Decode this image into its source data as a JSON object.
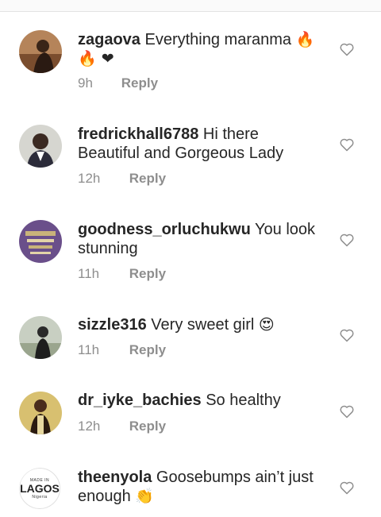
{
  "reply_label": "Reply",
  "comments": [
    {
      "username": "zagaova",
      "text": "Everything maranma",
      "emoji": "🔥 🔥 ❤",
      "time": "9h"
    },
    {
      "username": "fredrickhall6788",
      "text": "Hi there Beautiful and Gorgeous Lady",
      "emoji": "",
      "time": "12h"
    },
    {
      "username": "goodness_orluchukwu",
      "text": "You look stunning",
      "emoji": "",
      "time": "11h"
    },
    {
      "username": "sizzle316",
      "text": "Very sweet girl",
      "emoji": "😍",
      "time": "11h"
    },
    {
      "username": "dr_iyke_bachies",
      "text": "So healthy",
      "emoji": "",
      "time": "12h"
    },
    {
      "username": "theenyola",
      "text": "Goosebumps ain’t just enough",
      "emoji": "👏",
      "time": ""
    }
  ],
  "avatar_logo": {
    "small_top": "MADE IN",
    "brand": "LAGOS",
    "small_bottom": "Nigeria"
  },
  "icons": {
    "like": "heart-outline-icon"
  }
}
